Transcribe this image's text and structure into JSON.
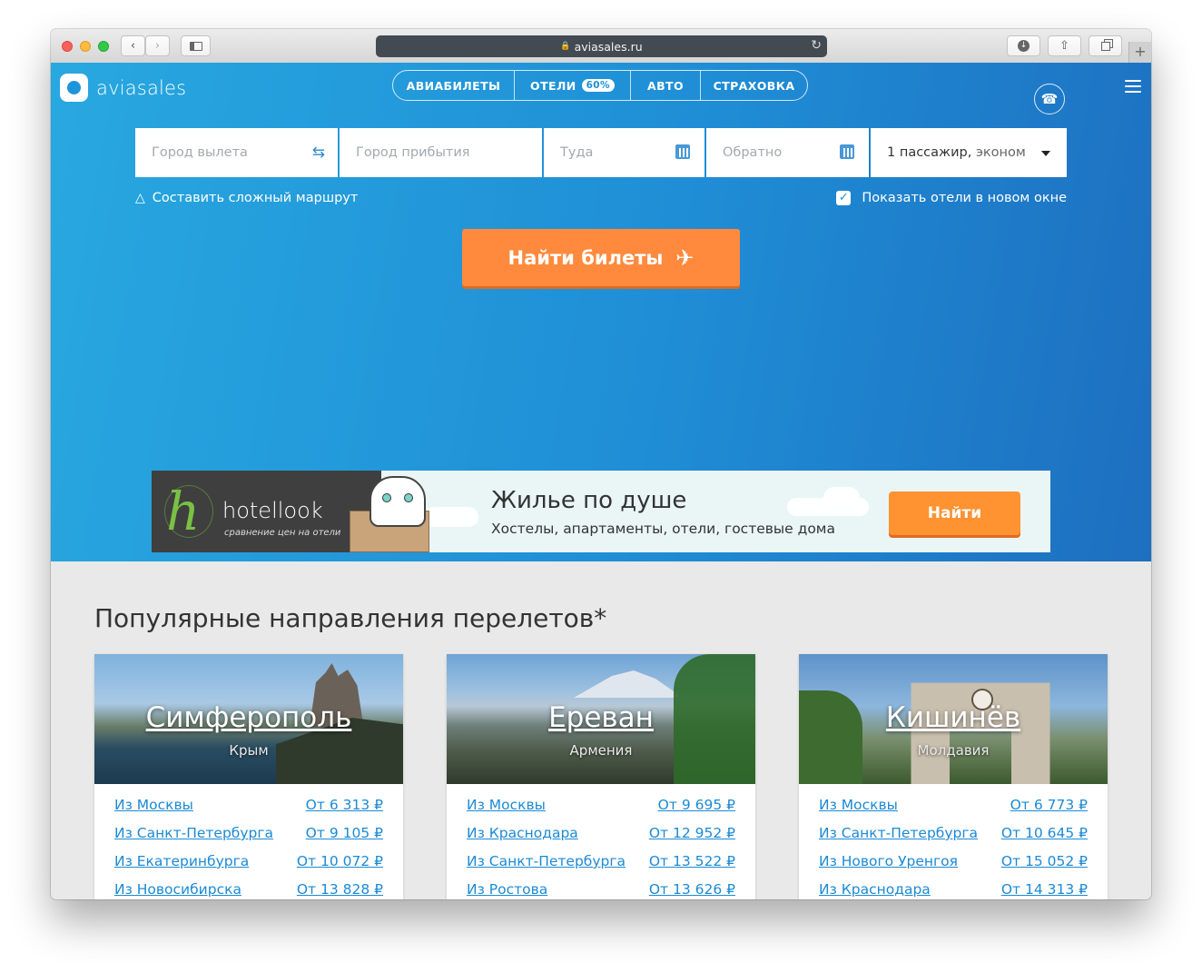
{
  "browser": {
    "url": "aviasales.ru"
  },
  "header": {
    "logo": "aviasales",
    "tabs": [
      {
        "label": "АВИАБИЛЕТЫ"
      },
      {
        "label": "ОТЕЛИ",
        "badge": "60%"
      },
      {
        "label": "АВТО"
      },
      {
        "label": "СТРАХОВКА"
      }
    ]
  },
  "search": {
    "origin_placeholder": "Город вылета",
    "destination_placeholder": "Город прибытия",
    "depart_placeholder": "Туда",
    "return_placeholder": "Обратно",
    "passengers_count": "1 пассажир,",
    "passengers_class": " эконом",
    "complex_route": "Составить сложный маршрут",
    "show_hotels": "Показать отели в новом окне",
    "show_hotels_checked": true,
    "find_button": "Найти билеты"
  },
  "banner": {
    "brand": "hotellook",
    "tagline": "сравнение цен на отели",
    "title": "Жилье по душе",
    "subtitle": "Хостелы, апартаменты, отели, гостевые дома",
    "button": "Найти"
  },
  "popular": {
    "title": "Популярные направления перелетов*",
    "cards": [
      {
        "city": "Симферополь",
        "region": "Крым",
        "routes": [
          {
            "from": "Из Москвы",
            "price": "От 6 313 ₽"
          },
          {
            "from": "Из Санкт-Петербурга",
            "price": "От 9 105 ₽"
          },
          {
            "from": "Из Екатеринбурга",
            "price": "От 10 072 ₽"
          },
          {
            "from": "Из Новосибирска",
            "price": "От 13 828 ₽"
          }
        ]
      },
      {
        "city": "Ереван",
        "region": "Армения",
        "routes": [
          {
            "from": "Из Москвы",
            "price": "От 9 695 ₽"
          },
          {
            "from": "Из Краснодара",
            "price": "От 12 952 ₽"
          },
          {
            "from": "Из Санкт-Петербурга",
            "price": "От 13 522 ₽"
          },
          {
            "from": "Из Ростова",
            "price": "От 13 626 ₽"
          }
        ]
      },
      {
        "city": "Кишинёв",
        "region": "Молдавия",
        "routes": [
          {
            "from": "Из Москвы",
            "price": "От 6 773 ₽"
          },
          {
            "from": "Из Санкт-Петербурга",
            "price": "От 10 645 ₽"
          },
          {
            "from": "Из Нового Уренгоя",
            "price": "От 15 052 ₽"
          },
          {
            "from": "Из Краснодара",
            "price": "От 14 313 ₽"
          }
        ]
      }
    ]
  },
  "colors": {
    "hero_start": "#28a8e0",
    "hero_end": "#1e6fc0",
    "accent_orange": "#ff8a3d",
    "link_blue": "#1c8ad4"
  }
}
